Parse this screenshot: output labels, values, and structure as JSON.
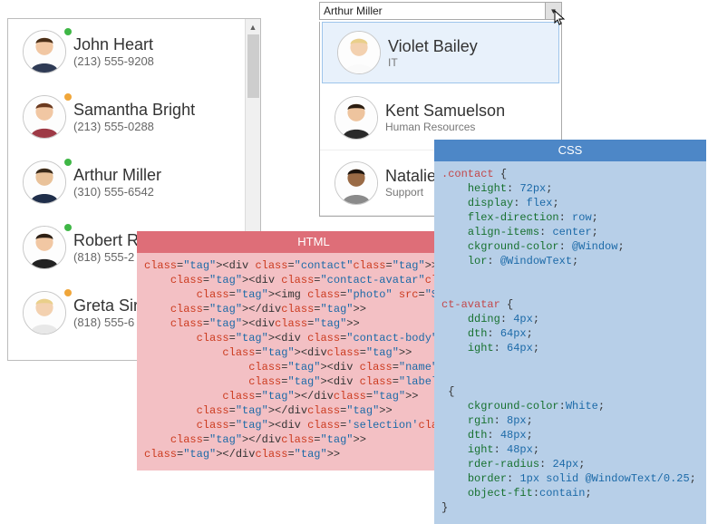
{
  "left_list": {
    "items": [
      {
        "name": "John Heart",
        "phone": "(213) 555-9208",
        "status": "#3fb746"
      },
      {
        "name": "Samantha Bright",
        "phone": "(213) 555-0288",
        "status": "#f0a63a"
      },
      {
        "name": "Arthur Miller",
        "phone": "(310) 555-6542",
        "status": "#3fb746"
      },
      {
        "name": "Robert R",
        "phone": "(818) 555-2",
        "status": "#3fb746"
      },
      {
        "name": "Greta Sir",
        "phone": "(818) 555-6",
        "status": "#f0a63a"
      }
    ]
  },
  "combo": {
    "value": "Arthur Miller"
  },
  "dropdown": {
    "items": [
      {
        "name": "Violet Bailey",
        "dept": "IT",
        "selected": true
      },
      {
        "name": "Kent Samuelson",
        "dept": "Human Resources",
        "selected": false
      },
      {
        "name": "Natalie",
        "dept": "Support",
        "selected": false
      }
    ]
  },
  "html_panel": {
    "title": "HTML",
    "lines": [
      "<div class=\"contact\">",
      "    <div class=\"contact-avatar\">",
      "        <img class=\"photo\" src=\"${Photo}\" />",
      "    </div>",
      "    <div>",
      "        <div class=\"contact-body\">",
      "            <div>",
      "                <div class=\"name\">${FirstName} {LastN",
      "                <div class=\"label\">${Department}</div",
      "            </div>",
      "        </div>",
      "        <div class='selection'></div>",
      "    </div>",
      "</div>"
    ]
  },
  "css_panel": {
    "title": "CSS",
    "lines": [
      ".contact {",
      "    height: 72px;",
      "    display: flex;",
      "    flex-direction: row;",
      "    align-items: center;",
      "    ckground-color: @Window;",
      "    lor: @WindowText;",
      "",
      "",
      "ct-avatar {",
      "    dding: 4px;",
      "    dth: 64px;",
      "    ight: 64px;",
      "",
      "",
      " {",
      "    ckground-color:White;",
      "    rgin: 8px;",
      "    dth: 48px;",
      "    ight: 48px;",
      "    rder-radius: 24px;",
      "    border: 1px solid @WindowText/0.25;",
      "    object-fit:contain;",
      "}"
    ]
  }
}
